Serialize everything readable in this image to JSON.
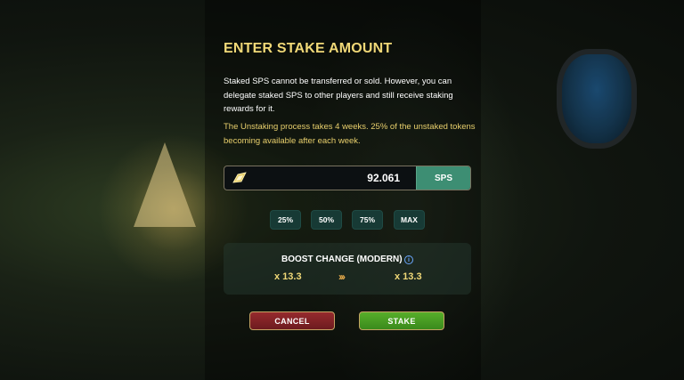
{
  "dialog": {
    "title": "ENTER STAKE AMOUNT",
    "description": "Staked SPS cannot be transferred or sold. However, you can delegate staked SPS to other players and still receive staking rewards for it.",
    "unstake_note": "The Unstaking process takes 4 weeks. 25% of the unstaked tokens becoming available after each week."
  },
  "amount": {
    "value": "92.061",
    "currency": "SPS",
    "icon": "sps-token-icon"
  },
  "percent_buttons": [
    "25%",
    "50%",
    "75%",
    "MAX"
  ],
  "boost": {
    "title": "BOOST CHANGE (MODERN)",
    "info_icon": "i",
    "from": "x 13.3",
    "arrows": "›››",
    "to": "x 13.3"
  },
  "actions": {
    "cancel_label": "CANCEL",
    "stake_label": "STAKE"
  },
  "colors": {
    "title_gold": "#f0d877",
    "note_gold": "#e8cf6c",
    "sps_tag": "#3d8e73",
    "cancel_red": "#962a2d",
    "stake_green": "#57ae2a"
  }
}
